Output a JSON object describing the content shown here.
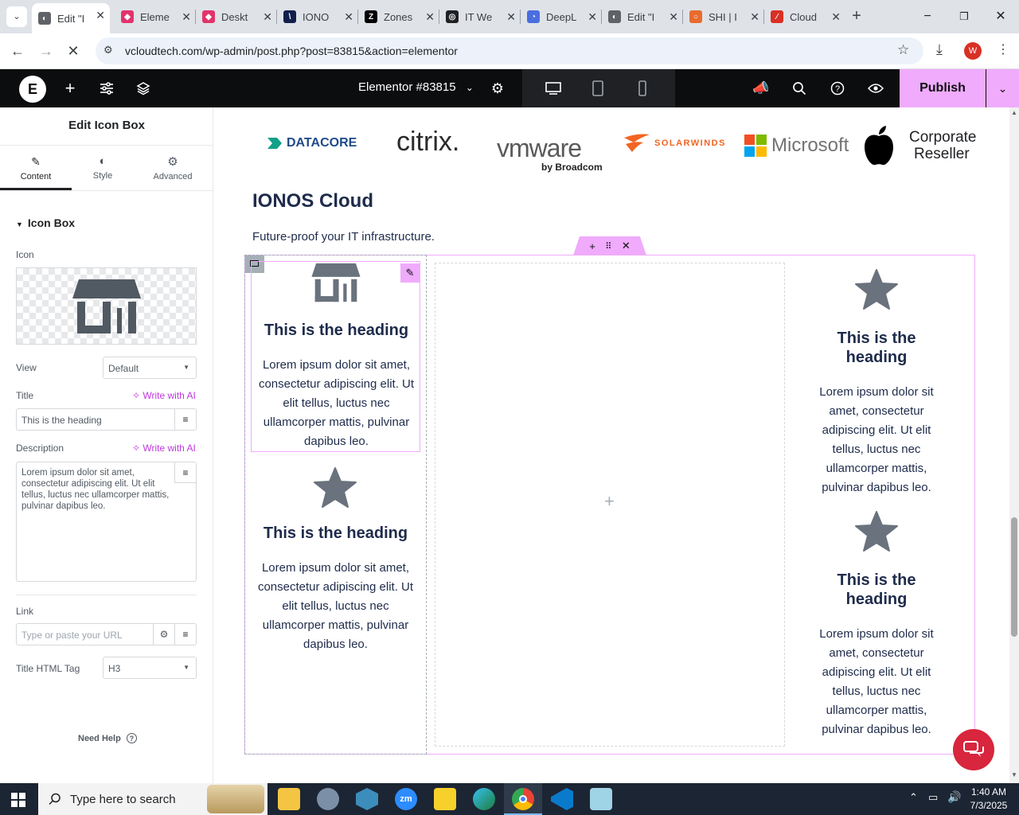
{
  "browser": {
    "tabs": [
      {
        "label": "Edit \"I",
        "color": "#5f6368",
        "glyph": "◐",
        "active": true
      },
      {
        "label": "Eleme",
        "color": "#e2336b",
        "glyph": "◆"
      },
      {
        "label": "Deskt",
        "color": "#e2336b",
        "glyph": "◆"
      },
      {
        "label": "IONO",
        "color": "#11204b",
        "glyph": "\\"
      },
      {
        "label": "Zones",
        "color": "#000000",
        "glyph": "Z"
      },
      {
        "label": "IT We",
        "color": "#202124",
        "glyph": "◎"
      },
      {
        "label": "DeepL",
        "color": "#4a6ee0",
        "glyph": "◔"
      },
      {
        "label": "Edit \"I",
        "color": "#5f6368",
        "glyph": "◐"
      },
      {
        "label": "SHI | I",
        "color": "#e96b2e",
        "glyph": "○"
      },
      {
        "label": "Cloud",
        "color": "#d93025",
        "glyph": "∕"
      }
    ],
    "url": "vcloudtech.com/wp-admin/post.php?post=83815&action=elementor",
    "profile_initial": "W"
  },
  "elementor_bar": {
    "doc_title": "Elementor #83815",
    "publish_label": "Publish"
  },
  "panel": {
    "title": "Edit Icon Box",
    "tabs": [
      {
        "label": "Content",
        "icon": "pencil-icon"
      },
      {
        "label": "Style",
        "icon": "contrast-icon"
      },
      {
        "label": "Advanced",
        "icon": "gear-icon"
      }
    ],
    "section_title": "Icon Box",
    "icon_label": "Icon",
    "view_label": "View",
    "view_value": "Default",
    "title_label": "Title",
    "write_ai": "Write with AI",
    "title_value": "This is the heading",
    "description_label": "Description",
    "description_value": "Lorem ipsum dolor sit amet, consectetur adipiscing elit. Ut elit tellus, luctus nec ullamcorper mattis, pulvinar dapibus leo.",
    "link_label": "Link",
    "link_placeholder": "Type or paste your URL",
    "tag_label": "Title HTML Tag",
    "tag_value": "H3",
    "need_help": "Need Help"
  },
  "canvas": {
    "partner_logos": [
      "DATACORE",
      "citrix.",
      "vmware",
      "by Broadcom",
      "SOLARWINDS",
      "Microsoft",
      "Corporate",
      "Reseller"
    ],
    "section_heading": "IONOS Cloud",
    "section_sub": "Future-proof your IT infrastructure.",
    "box1_heading": "This is the heading",
    "box1_desc": "Lorem ipsum dolor sit amet, consectetur adipiscing elit. Ut elit tellus, luctus nec ullamcorper mattis, pulvinar dapibus leo.",
    "box2_heading": "This is the heading",
    "box2_desc": "Lorem ipsum dolor sit amet, consectetur adipiscing elit. Ut elit tellus, luctus nec ullamcorper mattis, pulvinar dapibus leo.",
    "box3_heading": "This is the heading",
    "box3_desc": "Lorem ipsum dolor sit amet, consectetur adipiscing elit. Ut elit tellus, luctus nec ullamcorper mattis, pulvinar dapibus leo.",
    "box4_heading": "This is the heading",
    "box4_desc": "Lorem ipsum dolor sit amet, consectetur adipiscing elit. Ut elit tellus, luctus nec ullamcorper mattis, pulvinar dapibus leo."
  },
  "taskbar": {
    "search_placeholder": "Type here to search",
    "time": "1:40 AM",
    "date": "7/3/2025"
  },
  "colors": {
    "accent": "#f0abfc",
    "ai": "#c036e0",
    "heading": "#1e2b4b",
    "icon_gray": "#69727d"
  }
}
